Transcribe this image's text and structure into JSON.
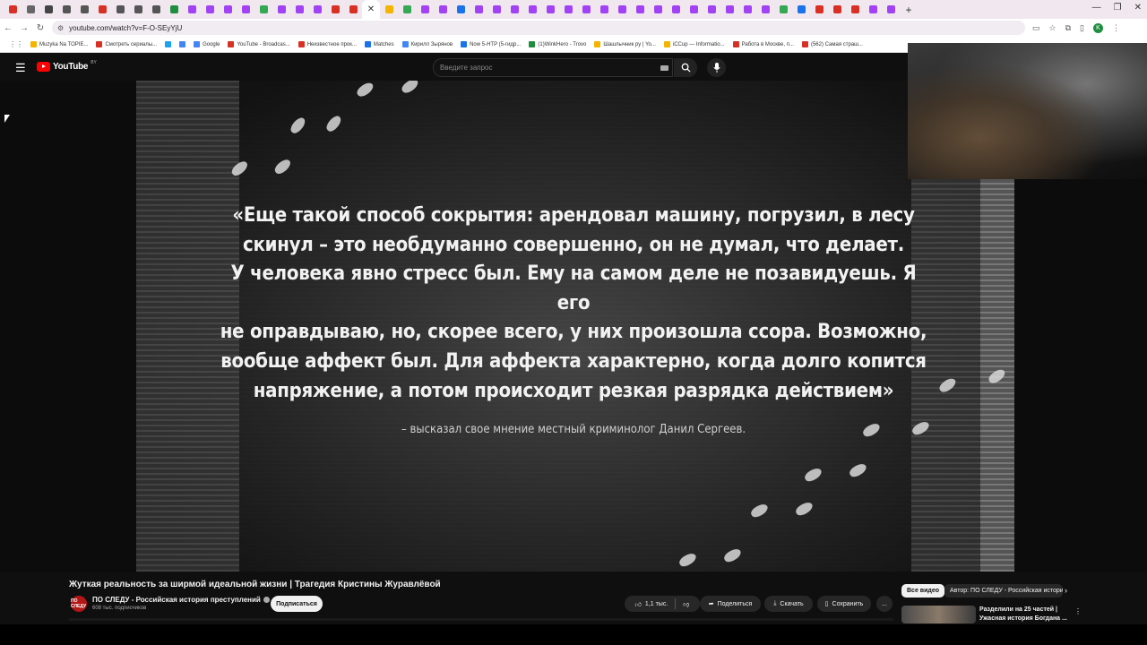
{
  "browser": {
    "tab_count": 50,
    "tab_colors": [
      "#d93025",
      "#666666",
      "#444444",
      "#555555",
      "#555555",
      "#d93025",
      "#555555",
      "#555555",
      "#555555",
      "#1e8e3e",
      "#a142f4",
      "#a142f4",
      "#a142f4",
      "#a142f4",
      "#34a853",
      "#a142f4",
      "#a142f4",
      "#a142f4",
      "#d93025",
      "#d93025",
      "#ffffff",
      "#f4b400",
      "#34a853",
      "#a142f4",
      "#a142f4",
      "#1a73e8",
      "#a142f4",
      "#a142f4",
      "#a142f4",
      "#a142f4",
      "#a142f4",
      "#a142f4",
      "#a142f4",
      "#a142f4",
      "#a142f4",
      "#a142f4",
      "#a142f4",
      "#a142f4",
      "#a142f4",
      "#a142f4",
      "#a142f4",
      "#a142f4",
      "#a142f4",
      "#34a853",
      "#1a73e8",
      "#d93025",
      "#d93025",
      "#d93025",
      "#a142f4",
      "#a142f4"
    ],
    "active_tab_index": 20,
    "new_tab": "+",
    "url": "youtube.com/watch?v=F-O-SEyYjU",
    "profile_initial": "K",
    "bookmarks": [
      {
        "label": "Muzyka Na TOPIE...",
        "color": "#f4b400"
      },
      {
        "label": "Смотреть сериалы...",
        "color": "#d93025"
      },
      {
        "label": "",
        "color": "#1da1f2"
      },
      {
        "label": "",
        "color": "#4285f4"
      },
      {
        "label": "Google",
        "color": "#4285f4"
      },
      {
        "label": "YouTube - Broadcas...",
        "color": "#d93025"
      },
      {
        "label": "Неизвестное прок...",
        "color": "#d93025"
      },
      {
        "label": "Matches",
        "color": "#1a73e8"
      },
      {
        "label": "Кирилл Зырянов",
        "color": "#4285f4"
      },
      {
        "label": "Now 5-HTP (5-гидр...",
        "color": "#1a73e8"
      },
      {
        "label": "(1)WinkHero - Trovo",
        "color": "#1e8e3e"
      },
      {
        "label": "Шашлычник ру | Yo...",
        "color": "#f4b400"
      },
      {
        "label": "iCCup — Informatio...",
        "color": "#f4b400"
      },
      {
        "label": "Работа в Москве, п...",
        "color": "#d93025"
      },
      {
        "label": "(562) Самая страш...",
        "color": "#d93025"
      }
    ]
  },
  "youtube": {
    "logo_text": "YouTube",
    "region": "BY",
    "search_placeholder": "Введите запрос"
  },
  "video": {
    "quote": "«Еще такой способ сокрытия: арендовал машину, погрузил, в лесу скинул – это необдуманно совершенно, он не думал, что делает. У человека явно стресс был. Ему на самом деле не позавидуешь. Я его не оправдываю, но, скорее всего, у них произошла ссора. Возможно, вообще аффект был. Для аффекта характерно, когда долго копится напряжение, а потом происходит резкая разрядка действием»",
    "quote_lines": [
      "«Еще такой способ сокрытия: арендовал машину, погрузил, в лесу",
      "скинул – это необдуманно совершенно, он не думал, что делает.",
      "У человека явно стресс был. Ему на самом деле не позавидуешь. Я его",
      "не оправдываю, но, скорее всего, у них произошла ссора. Возможно,",
      "вообще аффект был. Для аффекта характерно, когда долго копится",
      "напряжение, а потом происходит резкая разрядка действием»"
    ],
    "attribution": "– высказал свое мнение местный криминолог Данил Сергеев.",
    "title": "Жуткая реальность за ширмой идеальной жизни | Трагедия Кристины Журавлёвой"
  },
  "channel": {
    "avatar_text": "ПО СЛЕДУ",
    "name": "ПО СЛЕДУ - Российская история преступлений",
    "subscribers": "608 тыс. подписчиков",
    "subscribe_label": "Подписаться"
  },
  "actions": {
    "likes": "1,1 тыс.",
    "share": "Поделиться",
    "download": "Скачать",
    "save": "Сохранить",
    "more": "..."
  },
  "sidebar": {
    "chip_all": "Все видео",
    "chip_author": "Автор: ПО СЛЕДУ - Российская история",
    "rec_title": "Разделили на 25 частей | Ужасная история Богдана ..."
  }
}
